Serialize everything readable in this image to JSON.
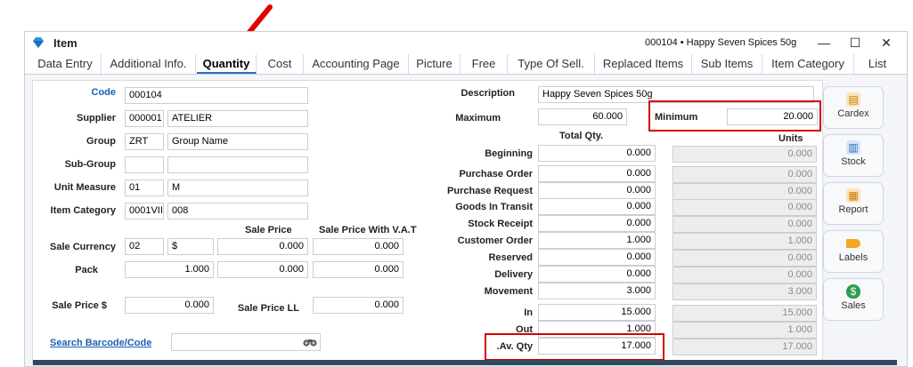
{
  "window": {
    "title": "Item",
    "record_info": "000104  •  Happy Seven Spices 50g",
    "minimize": "—",
    "maximize": "☐",
    "close": "✕"
  },
  "tabs": [
    "Data Entry",
    "Additional Info.",
    "Quantity",
    "Cost",
    "Accounting Page",
    "Picture",
    "Free",
    "Type Of Sell.",
    "Replaced Items",
    "Sub Items",
    "Item Category",
    "List"
  ],
  "left": {
    "code_label": "Code",
    "code": "000104",
    "supplier_label": "Supplier",
    "supplier_code": "000001",
    "supplier_name": "ATELIER",
    "group_label": "Group",
    "group_code": "ZRT",
    "group_name": "Group Name",
    "subgroup_label": "Sub-Group",
    "subgroup_code": "",
    "subgroup_name": "",
    "unit_label": "Unit Measure",
    "unit_code": "01",
    "unit_name": "M",
    "category_label": "Item Category",
    "category_code": "0001VII",
    "category_name": "008",
    "sale_price_hdr": "Sale Price",
    "sale_price_vat_hdr": "Sale Price With V.A.T",
    "sale_currency_label": "Sale Currency",
    "currency_code": "02",
    "currency_symbol": "$",
    "currency_sale_price": "0.000",
    "currency_sale_price_vat": "0.000",
    "pack_label": "Pack",
    "pack_value": "1.000",
    "pack_sale_price": "0.000",
    "pack_sale_price_vat": "0.000",
    "sale_price_usd_label": "Sale Price $",
    "sale_price_usd": "0.000",
    "sale_price_ll_label": "Sale Price LL",
    "sale_price_ll": "0.000",
    "barcode_link": "Search Barcode/Code",
    "barcode_value": ""
  },
  "right": {
    "description_label": "Description",
    "description": "Happy Seven Spices 50g",
    "maximum_label": "Maximum",
    "maximum": "60.000",
    "minimum_label": "Minimum",
    "minimum": "20.000",
    "total_qty_hdr": "Total Qty.",
    "units_hdr": "Units",
    "rows": [
      {
        "label": "Beginning",
        "qty": "0.000",
        "units": "0.000"
      },
      {
        "label": "Purchase Order",
        "qty": "0.000",
        "units": "0.000"
      },
      {
        "label": "Purchase Request",
        "qty": "0.000",
        "units": "0.000"
      },
      {
        "label": "Goods In Transit",
        "qty": "0.000",
        "units": "0.000"
      },
      {
        "label": "Stock Receipt",
        "qty": "0.000",
        "units": "0.000"
      },
      {
        "label": "Customer Order",
        "qty": "1.000",
        "units": "1.000"
      },
      {
        "label": "Reserved",
        "qty": "0.000",
        "units": "0.000"
      },
      {
        "label": "Delivery",
        "qty": "0.000",
        "units": "0.000"
      },
      {
        "label": "Movement",
        "qty": "3.000",
        "units": "3.000"
      },
      {
        "label": "In",
        "qty": "15.000",
        "units": "15.000"
      },
      {
        "label": "Out",
        "qty": "1.000",
        "units": "1.000"
      },
      {
        "label": ".Av. Qty",
        "qty": "17.000",
        "units": "17.000"
      }
    ]
  },
  "side_buttons": [
    {
      "label": "Cardex",
      "icon": "clipboard-icon",
      "color": "#f5a623"
    },
    {
      "label": "Stock",
      "icon": "stock-icon",
      "color": "#2a6fbf"
    },
    {
      "label": "Report",
      "icon": "report-icon",
      "color": "#f5a623"
    },
    {
      "label": "Labels",
      "icon": "label-tag-icon",
      "color": "#f5a623"
    },
    {
      "label": "Sales",
      "icon": "money-bag-icon",
      "color": "#2e9e4f"
    }
  ],
  "annotations": {
    "highlight_color": "#d40000"
  }
}
